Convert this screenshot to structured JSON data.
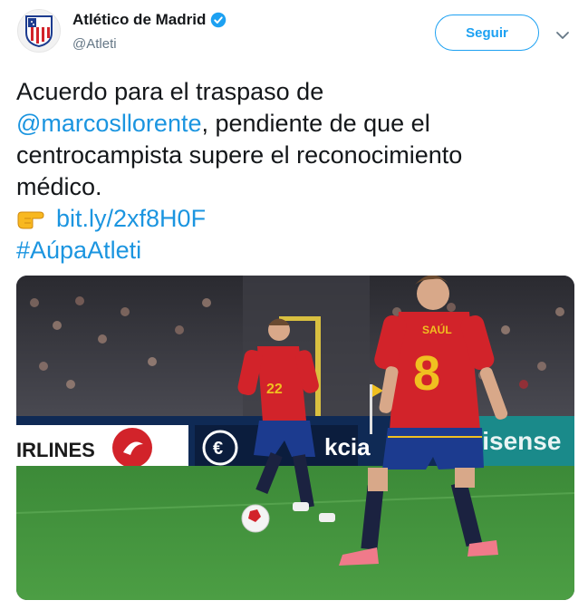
{
  "account": {
    "display_name": "Atlético de Madrid",
    "handle": "@Atleti",
    "avatar_icon": "atletico-crest-icon",
    "verified_icon": "verified-badge-icon"
  },
  "actions": {
    "follow_label": "Seguir",
    "more_icon": "chevron-down-icon"
  },
  "tweet": {
    "line1": "Acuerdo para el traspaso de",
    "mention": "@marcosllorente",
    "line2_rest": ", pendiente de que el",
    "line3": "centrocampista supere el reconocimiento",
    "line4": "médico.",
    "emoji_icon": "pointing-hand-icon",
    "link": "bit.ly/2xf8H0F",
    "hashtag": "#AúpaAtleti"
  },
  "media": {
    "board_text_left": "IRLINES",
    "board_text_mid": "kcia",
    "board_text_right": "Hisense",
    "player_back_name": "SAÚL",
    "player_back_number": "8",
    "player_front_number": "22"
  },
  "colors": {
    "brand_blue": "#1da1f2",
    "link_blue": "#1b95e0",
    "spain_red": "#d2232a",
    "spain_blue": "#1c3b8f",
    "pitch_green": "#3f8a3a"
  }
}
